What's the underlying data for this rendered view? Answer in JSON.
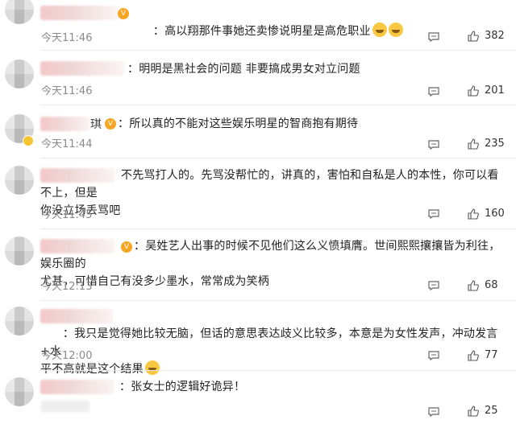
{
  "comments": [
    {
      "text": "：高以翔那件事她还卖惨说明星是高危职业",
      "emoji": "crying-face-icon",
      "time": "今天11:46",
      "likes": "382"
    },
    {
      "text": "：明明是黑社会的问题 非要搞成男女对立问题",
      "time": "今天11:46",
      "likes": "201"
    },
    {
      "name_tail": "琪",
      "text": "：所以真的不能对这些娱乐明星的智商抱有期待",
      "time": "今天11:44",
      "likes": "235"
    },
    {
      "text": "不先骂打人的。先骂没帮忙的，讲真的，害怕和自私是人的本性，你可以看不上，但是\n你没立场丢骂吧",
      "time": "今天11:45",
      "likes": "160"
    },
    {
      "text": "：吴姓艺人出事的时候不见他们这么义愤填膺。世间熙熙攘攘皆为利往，娱乐圈的\n尤甚，可惜自己有没多少墨水，常常成为笑柄",
      "time": "今天12:13",
      "likes": "68"
    },
    {
      "text": "：我只是觉得她比较无脑，但话的意思表达歧义比较多，本意是为女性发声，冲动发言+水\n平不高就是这个结果",
      "emoji": "grinning-face-icon",
      "time": "今天12:00",
      "likes": "77"
    },
    {
      "text": "：张女士的逻辑好诡异！",
      "likes": "25"
    }
  ]
}
